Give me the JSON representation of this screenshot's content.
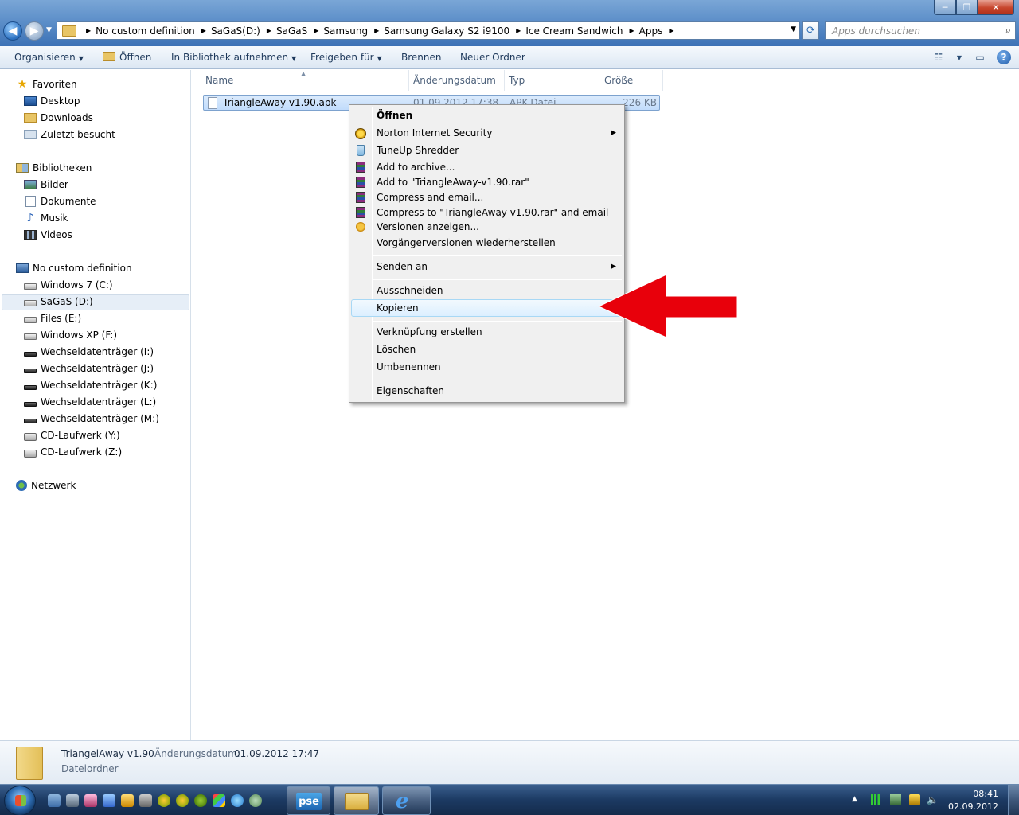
{
  "window": {
    "min_label": "─",
    "max_label": "❐",
    "close_label": "✕"
  },
  "address": {
    "crumbs": [
      "No custom definition",
      "SaGaS(D:)",
      "SaGaS",
      "Samsung",
      "Samsung Galaxy S2 i9100",
      "Ice Cream Sandwich",
      "Apps"
    ]
  },
  "search": {
    "placeholder": "Apps durchsuchen"
  },
  "toolbar": {
    "organize": "Organisieren",
    "open": "Öffnen",
    "library": "In Bibliothek aufnehmen",
    "share": "Freigeben für",
    "burn": "Brennen",
    "new_folder": "Neuer Ordner"
  },
  "sidebar": {
    "favorites": {
      "label": "Favoriten",
      "items": [
        "Desktop",
        "Downloads",
        "Zuletzt besucht"
      ]
    },
    "libraries": {
      "label": "Bibliotheken",
      "items": [
        "Bilder",
        "Dokumente",
        "Musik",
        "Videos"
      ]
    },
    "computer": {
      "label": "No custom definition",
      "items": [
        "Windows 7 (C:)",
        "SaGaS (D:)",
        "Files (E:)",
        "Windows XP (F:)",
        "Wechseldatenträger (I:)",
        "Wechseldatenträger (J:)",
        "Wechseldatenträger (K:)",
        "Wechseldatenträger (L:)",
        "Wechseldatenträger (M:)",
        "CD-Laufwerk (Y:)",
        "CD-Laufwerk (Z:)"
      ],
      "selected": "SaGaS (D:)"
    },
    "network": {
      "label": "Netzwerk"
    }
  },
  "filelist": {
    "columns": [
      "Name",
      "Änderungsdatum",
      "Typ",
      "Größe"
    ],
    "rows": [
      {
        "name": "TriangleAway-v1.90.apk",
        "date": "01.09.2012 17:38",
        "type": "APK-Datei",
        "size": "226 KB"
      }
    ]
  },
  "context_menu": {
    "items": [
      "Öffnen",
      "Norton Internet Security",
      "TuneUp Shredder",
      "Add to archive...",
      "Add to \"TriangleAway-v1.90.rar\"",
      "Compress and email...",
      "Compress to \"TriangleAway-v1.90.rar\" and email",
      "Versionen anzeigen...",
      "Vorgängerversionen wiederherstellen",
      "Senden an",
      "Ausschneiden",
      "Kopieren",
      "Verknüpfung erstellen",
      "Löschen",
      "Umbenennen",
      "Eigenschaften"
    ],
    "highlighted": "Kopieren"
  },
  "details": {
    "name": "TriangelAway v1.90",
    "date_label": "Änderungsdatum:",
    "date": "01.09.2012 17:47",
    "type": "Dateiordner"
  },
  "taskbar": {
    "pse_label": "pse",
    "ie_label": "e",
    "clock_time": "08:41",
    "clock_date": "02.09.2012"
  },
  "colors": {
    "accent_red": "#e8000b",
    "selection": "#c1dcfc"
  }
}
